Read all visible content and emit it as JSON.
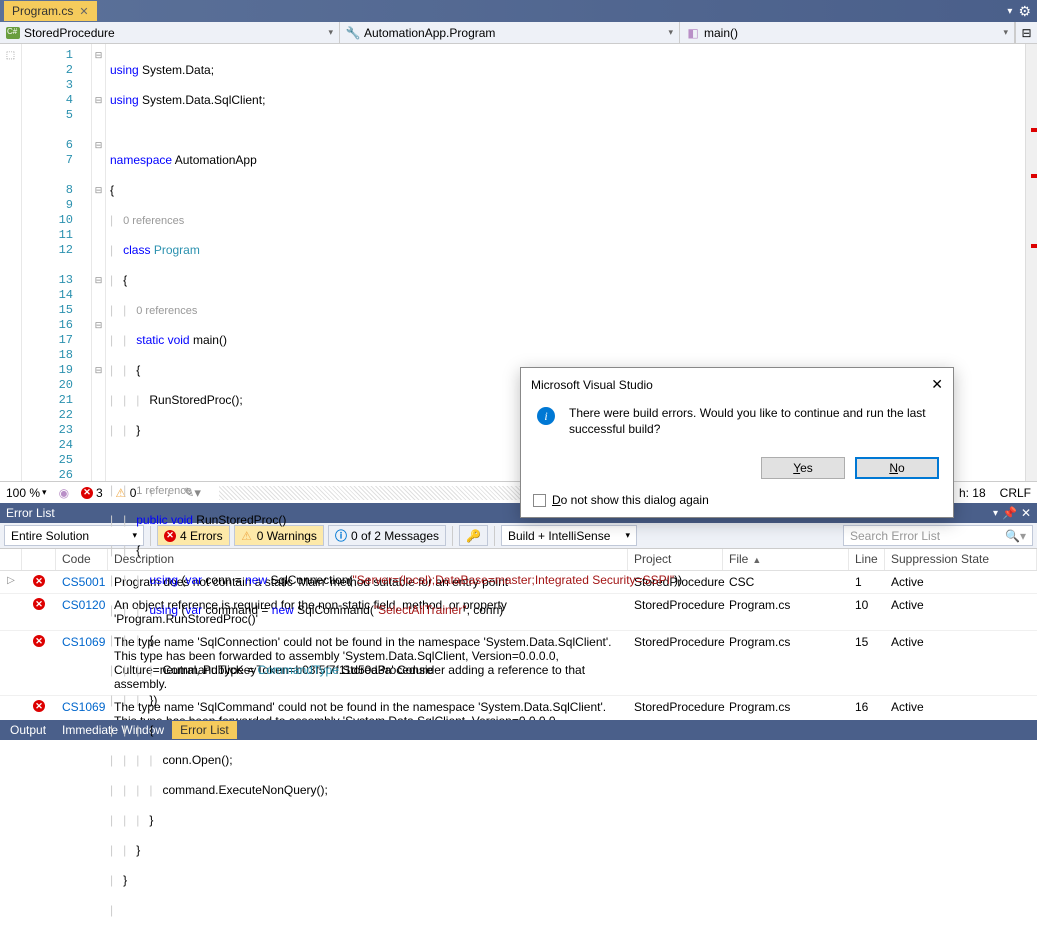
{
  "tab": {
    "file": "Program.cs"
  },
  "nav": {
    "project": "StoredProcedure",
    "class": "AutomationApp.Program",
    "method": "main()"
  },
  "lines": [
    "1",
    "2",
    "3",
    "4",
    "5",
    "6",
    "7",
    "8",
    "9",
    "10",
    "11",
    "12",
    "13",
    "14",
    "15",
    "16",
    "17",
    "18",
    "19",
    "20",
    "21",
    "22",
    "23",
    "24",
    "25",
    "26"
  ],
  "refs": {
    "r1": "0 references",
    "r2": "0 references",
    "r3": "1 reference"
  },
  "status": {
    "zoom": "100 %",
    "errs": "3",
    "warns": "0",
    "ch": "h: 18",
    "enc": "CRLF"
  },
  "err_panel": {
    "title": "Error List"
  },
  "toolbar": {
    "scope": "Entire Solution",
    "errs": "4 Errors",
    "warns": "0 Warnings",
    "msgs": "0 of 2 Messages",
    "source": "Build + IntelliSense",
    "search_ph": "Search Error List"
  },
  "cols": {
    "code": "Code",
    "desc": "Description",
    "proj": "Project",
    "file": "File",
    "line": "Line",
    "supp": "Suppression State"
  },
  "errors": [
    {
      "code": "CS5001",
      "desc": "Program does not contain a static 'Main' method suitable for an entry point",
      "proj": "StoredProcedure",
      "file": "CSC",
      "line": "1",
      "supp": "Active",
      "expand": true
    },
    {
      "code": "CS0120",
      "desc": "An object reference is required for the non-static field, method, or property 'Program.RunStoredProc()'",
      "proj": "StoredProcedure",
      "file": "Program.cs",
      "line": "10",
      "supp": "Active"
    },
    {
      "code": "CS1069",
      "desc": "The type name 'SqlConnection' could not be found in the namespace 'System.Data.SqlClient'. This type has been forwarded to assembly 'System.Data.SqlClient, Version=0.0.0.0, Culture=neutral, PublicKeyToken=b03f5f7f11d50a3a' Consider adding a reference to that assembly.",
      "proj": "StoredProcedure",
      "file": "Program.cs",
      "line": "15",
      "supp": "Active"
    },
    {
      "code": "CS1069",
      "desc": "The type name 'SqlCommand' could not be found in the namespace 'System.Data.SqlClient'. This type has been forwarded to assembly 'System.Data.SqlClient, Version=0.0.0.0, Culture=neutral, PublicKeyToken=b03f5f7f11d50a3a' Consider adding a reference to that assembly.",
      "proj": "StoredProcedure",
      "file": "Program.cs",
      "line": "16",
      "supp": "Active"
    }
  ],
  "dialog": {
    "title": "Microsoft Visual Studio",
    "msg": "There were build errors. Would you like to continue and run the last successful build?",
    "yes": "Yes",
    "no": "No",
    "chk": "Do not show this dialog again"
  },
  "tabs": {
    "output": "Output",
    "imm": "Immediate Window",
    "errlist": "Error List"
  }
}
